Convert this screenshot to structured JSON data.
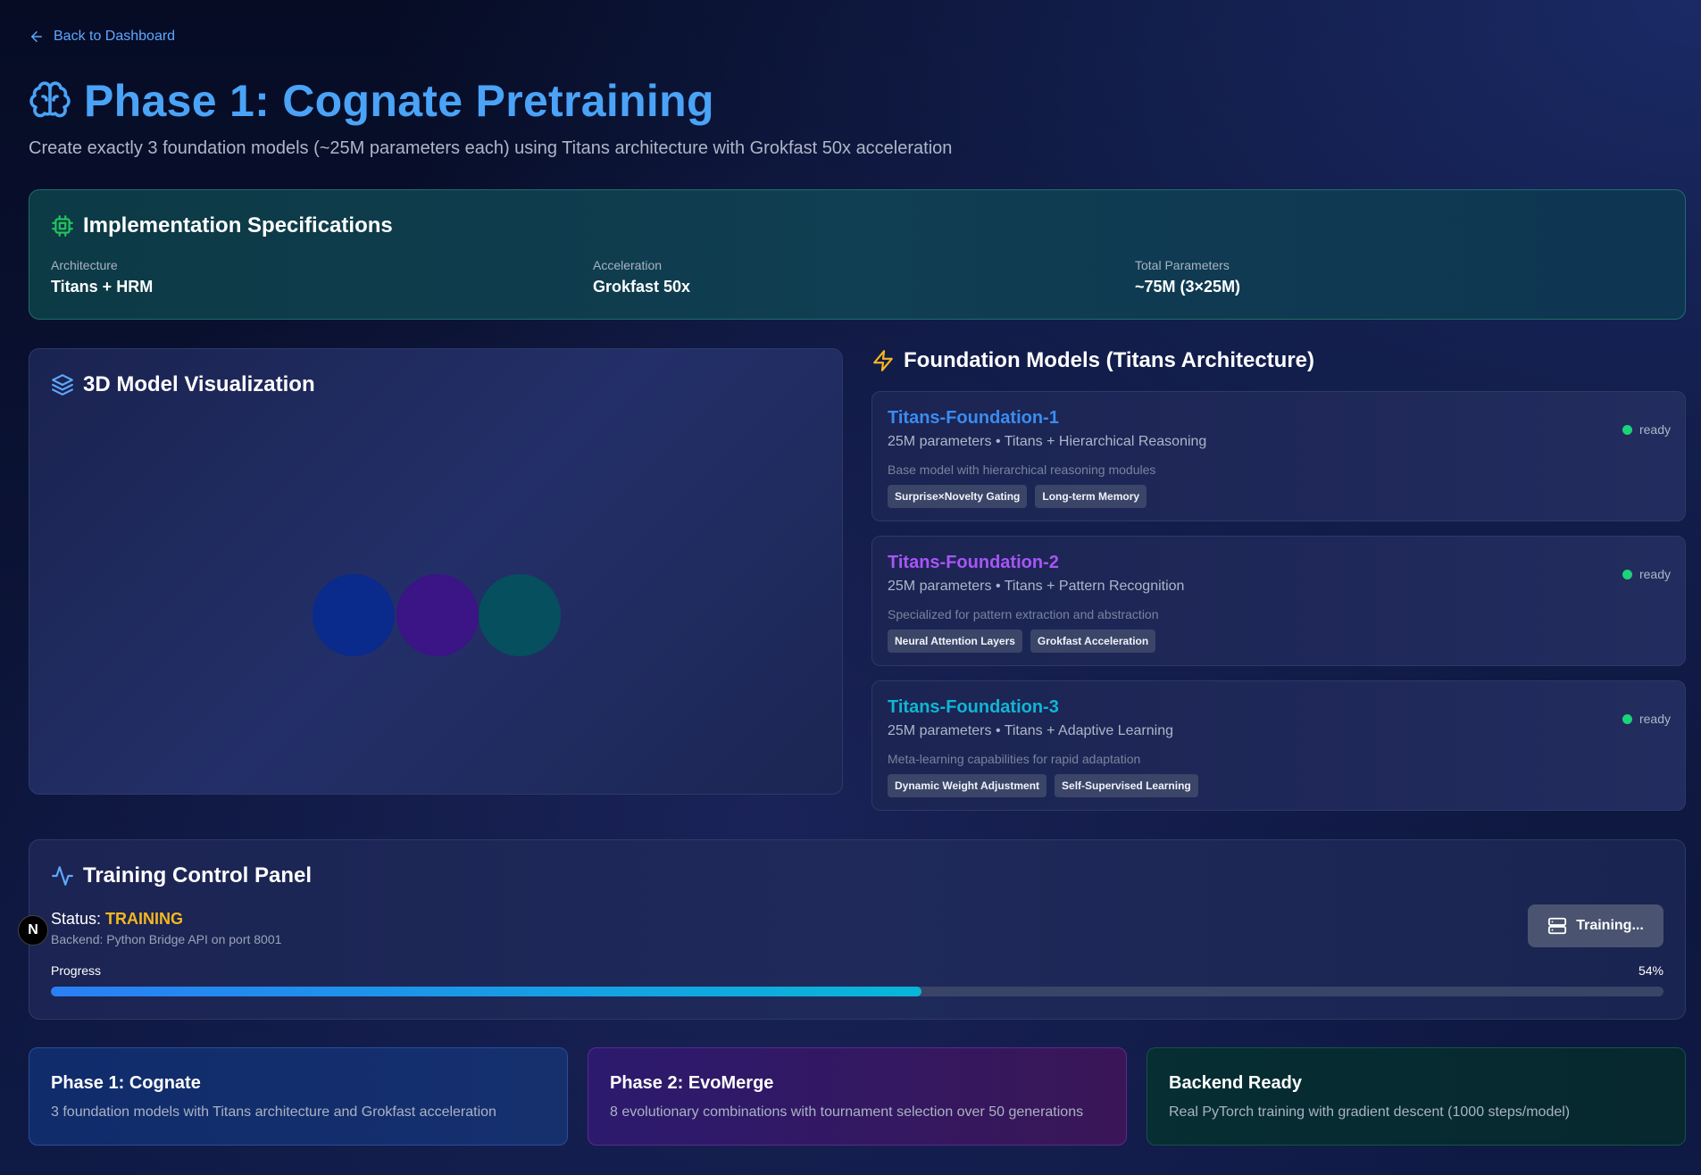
{
  "nav": {
    "back_label": "Back to Dashboard"
  },
  "header": {
    "title": "Phase 1: Cognate Pretraining",
    "subtitle": "Create exactly 3 foundation models (~25M parameters each) using Titans architecture with Grokfast 50x acceleration"
  },
  "specs": {
    "title": "Implementation Specifications",
    "items": [
      {
        "label": "Architecture",
        "value": "Titans + HRM"
      },
      {
        "label": "Acceleration",
        "value": "Grokfast 50x"
      },
      {
        "label": "Total Parameters",
        "value": "~75M (3×25M)"
      }
    ]
  },
  "visualization": {
    "title": "3D Model Visualization",
    "orb_colors": [
      "#0a2a8c",
      "#3b1485",
      "#064f5e"
    ]
  },
  "models": {
    "title": "Foundation Models (Titans Architecture)",
    "items": [
      {
        "name": "Titans-Foundation-1",
        "color": "#3b8cf0",
        "params": "25M parameters • Titans + Hierarchical Reasoning",
        "desc": "Base model with hierarchical reasoning modules",
        "tags": [
          "Surprise×Novelty Gating",
          "Long-term Memory"
        ],
        "status": "ready"
      },
      {
        "name": "Titans-Foundation-2",
        "color": "#a855f7",
        "params": "25M parameters • Titans + Pattern Recognition",
        "desc": "Specialized for pattern extraction and abstraction",
        "tags": [
          "Neural Attention Layers",
          "Grokfast Acceleration"
        ],
        "status": "ready"
      },
      {
        "name": "Titans-Foundation-3",
        "color": "#11b5d4",
        "params": "25M parameters • Titans + Adaptive Learning",
        "desc": "Meta-learning capabilities for rapid adaptation",
        "tags": [
          "Dynamic Weight Adjustment",
          "Self-Supervised Learning"
        ],
        "status": "ready"
      }
    ]
  },
  "training": {
    "title": "Training Control Panel",
    "status_label": "Status:",
    "status_value": "TRAINING",
    "backend": "Backend: Python Bridge API on port 8001",
    "button_label": "Training...",
    "progress_label": "Progress",
    "progress_text": "54%",
    "progress_fraction": 0.54
  },
  "next_badge": "N",
  "bottom_cards": [
    {
      "title": "Phase 1: Cognate",
      "desc": "3 foundation models with Titans architecture and Grokfast acceleration"
    },
    {
      "title": "Phase 2: EvoMerge",
      "desc": "8 evolutionary combinations with tournament selection over 50 generations"
    },
    {
      "title": "Backend Ready",
      "desc": "Real PyTorch training with gradient descent (1000 steps/model)"
    }
  ],
  "colors": {
    "accent": "#4aa3f7",
    "status_training": "#f5b71f",
    "ready": "#1bd37a"
  }
}
